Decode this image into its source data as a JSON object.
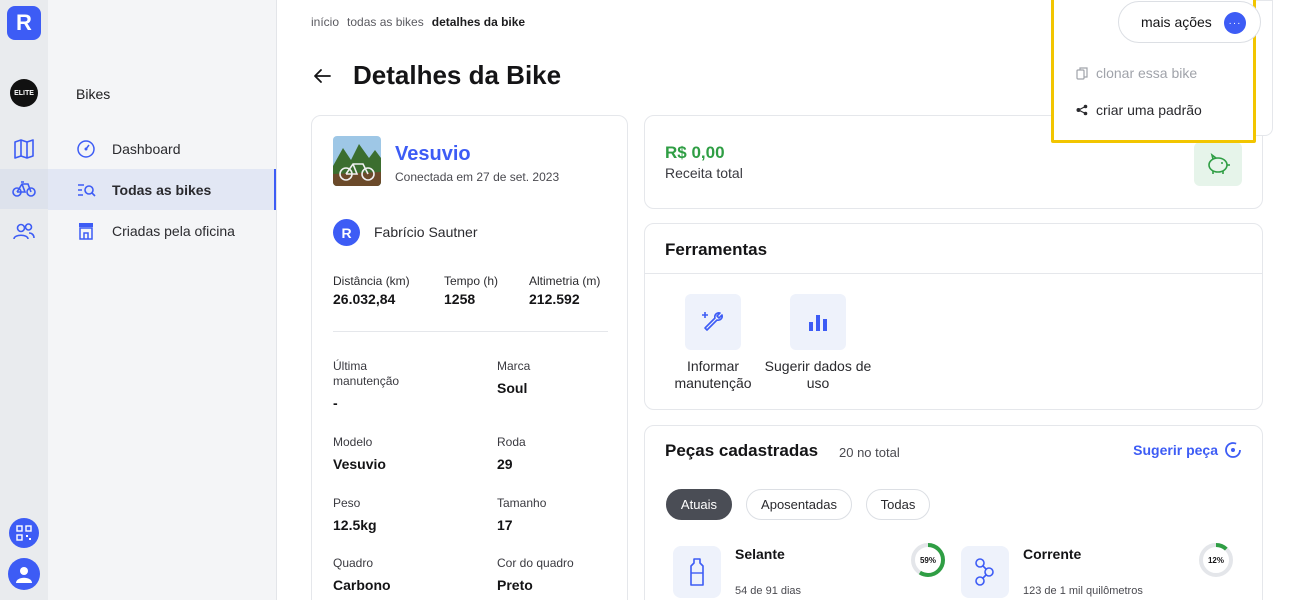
{
  "rail": {
    "logo_letter": "R",
    "workspace_badge": "ELITE"
  },
  "sidebar": {
    "section_title": "Bikes",
    "items": [
      {
        "label": "Dashboard"
      },
      {
        "label": "Todas as bikes"
      },
      {
        "label": "Criadas pela oficina"
      }
    ]
  },
  "breadcrumb": [
    "início",
    "todas as bikes",
    "detalhes da bike"
  ],
  "page_title": "Detalhes da Bike",
  "actions": {
    "more_label": "mais ações",
    "more_dots": "···",
    "options": [
      {
        "label": "clonar essa bike",
        "enabled": false
      },
      {
        "label": "criar uma padrão",
        "enabled": true
      }
    ]
  },
  "bike": {
    "name": "Vesuvio",
    "connected": "Conectada em 27 de set. 2023",
    "owner_initial": "R",
    "owner": "Fabrício Sautner",
    "stats": [
      {
        "label": "Distância (km)",
        "value": "26.032,84"
      },
      {
        "label": "Tempo (h)",
        "value": "1258"
      },
      {
        "label": "Altimetria (m)",
        "value": "212.592"
      }
    ],
    "fields": [
      {
        "label": "Última manutenção",
        "value": "-"
      },
      {
        "label": "Marca",
        "value": "Soul"
      },
      {
        "label": "Modelo",
        "value": "Vesuvio"
      },
      {
        "label": "Roda",
        "value": "29"
      },
      {
        "label": "Peso",
        "value": "12.5kg"
      },
      {
        "label": "Tamanho",
        "value": "17"
      },
      {
        "label": "Quadro",
        "value": "Carbono"
      },
      {
        "label": "Cor do quadro",
        "value": "Preto"
      }
    ]
  },
  "revenue": {
    "amount": "R$ 0,00",
    "label": "Receita total"
  },
  "tools": {
    "title": "Ferramentas",
    "items": [
      {
        "label": "Informar manutenção"
      },
      {
        "label": "Sugerir dados de uso"
      }
    ]
  },
  "parts": {
    "title": "Peças cadastradas",
    "count": "20 no total",
    "suggest_label": "Sugerir peça",
    "filters": [
      {
        "label": "Atuais",
        "active": true
      },
      {
        "label": "Aposentadas",
        "active": false
      },
      {
        "label": "Todas",
        "active": false
      }
    ],
    "items": [
      {
        "name": "Selante",
        "detail": "54 de 91 dias",
        "percent_label": "59%",
        "percent": 59,
        "color": "#2f9e44"
      },
      {
        "name": "Corrente",
        "detail": "123 de 1 mil quilômetros",
        "percent_label": "12%",
        "percent": 12,
        "color": "#2f9e44"
      }
    ]
  },
  "colors": {
    "accent": "#3d5cf5",
    "success": "#2f9e44",
    "highlight": "#f2c500"
  }
}
